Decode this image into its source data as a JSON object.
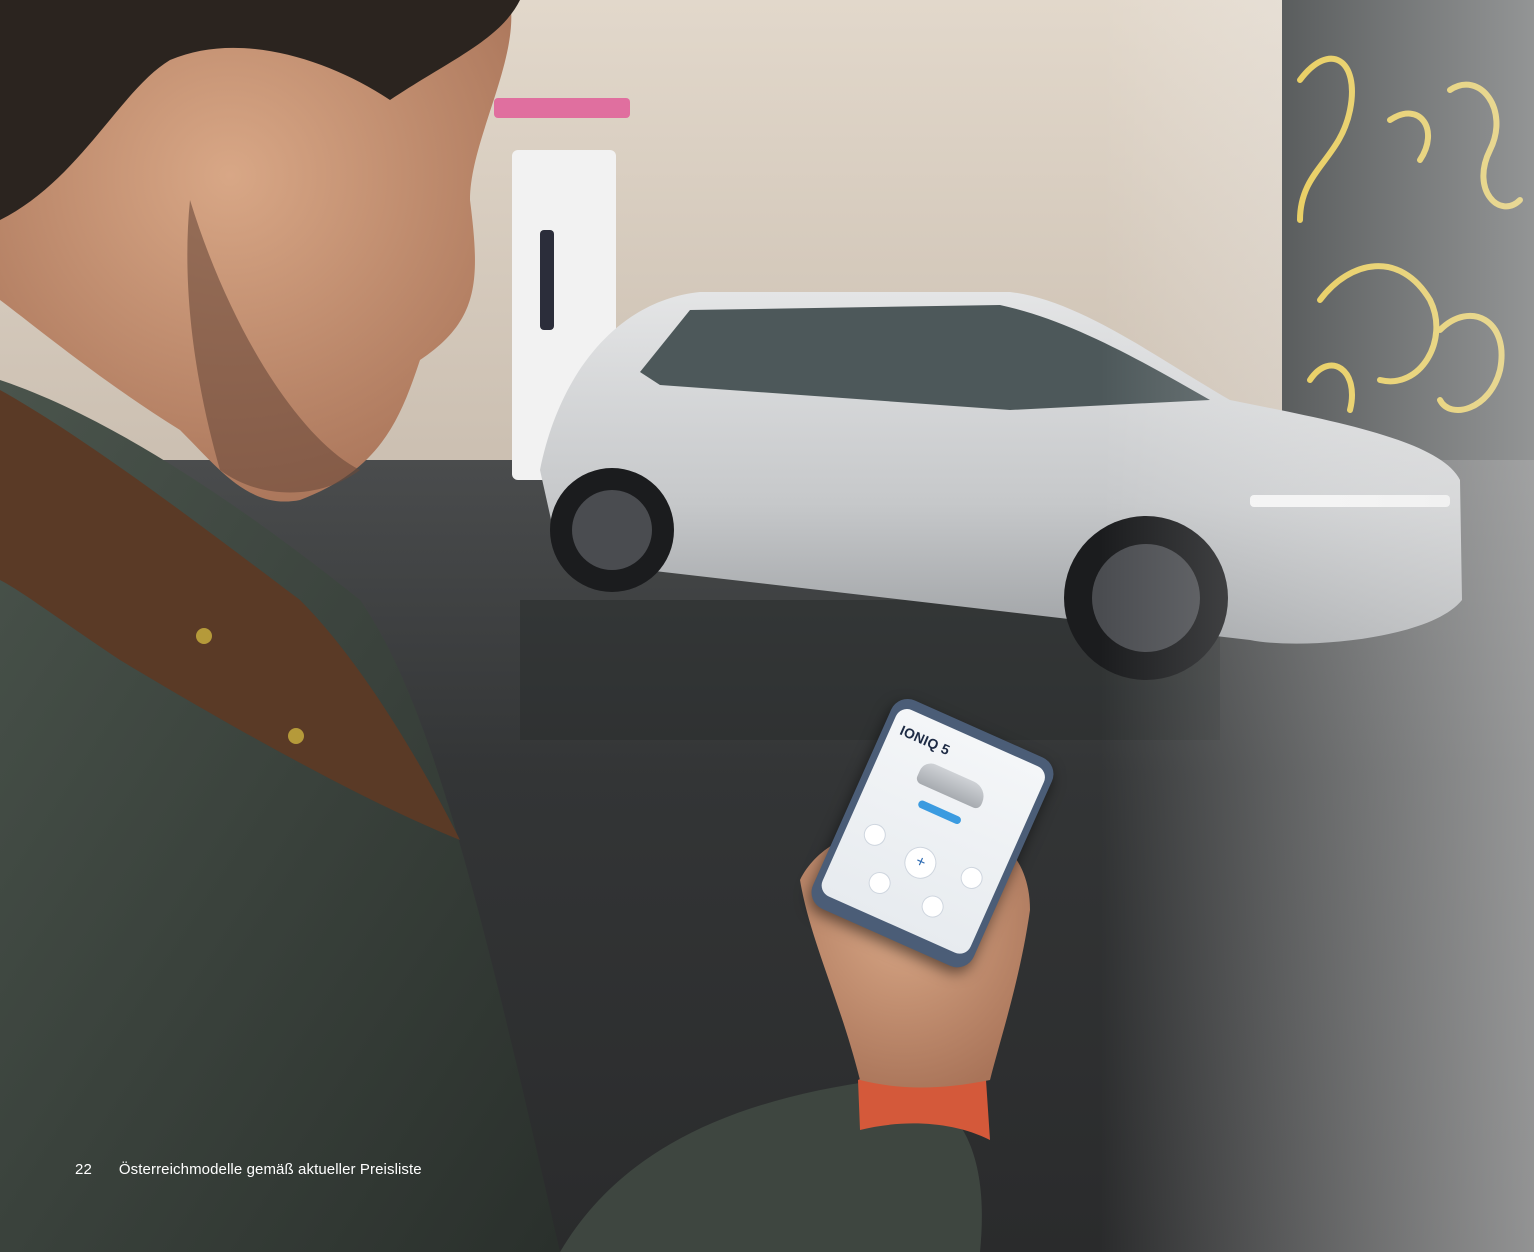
{
  "footer": {
    "page_number": "22",
    "note": "Österreichmodelle gemäß aktueller Preisliste"
  },
  "phone_screen": {
    "title": "IONIQ 5"
  },
  "colors": {
    "wall": "#d9cfc2",
    "asphalt": "#3a3c3d",
    "car": "#cfd0d0",
    "jacket": "#3f4841",
    "collar": "#5a3a26",
    "mural_yellow": "#e6c436",
    "mural_dark": "#2b2f30",
    "charger_pink": "#e0649a",
    "phone_case": "#4b5d77"
  },
  "icons": {
    "phone_center_button": "plus-icon"
  }
}
